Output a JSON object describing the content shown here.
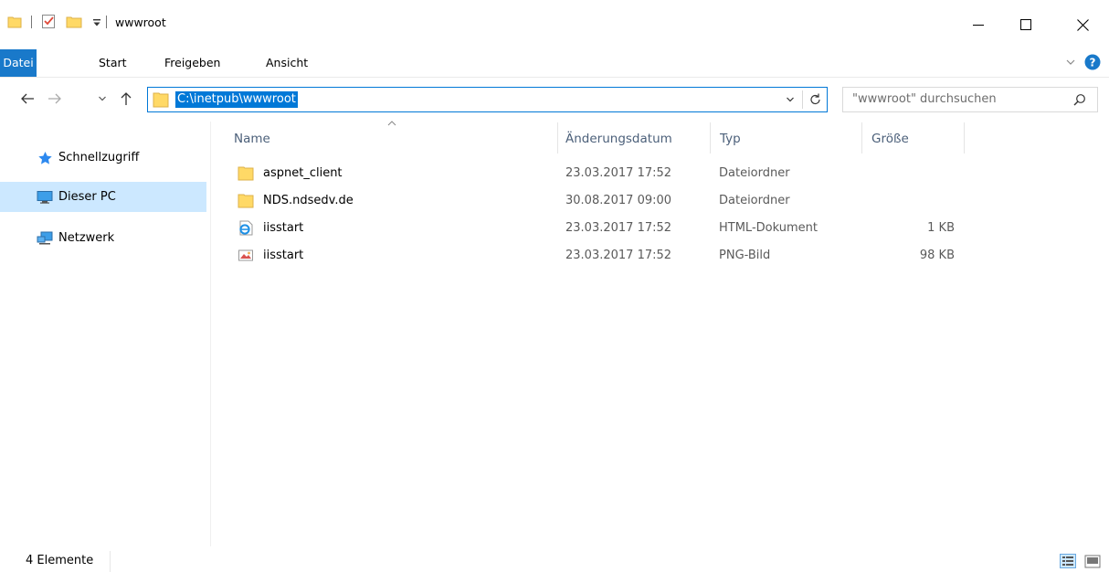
{
  "window": {
    "title": "wwwroot",
    "quick_access_icons": [
      "folder-icon",
      "properties-check-icon",
      "new-folder-icon",
      "customize-dropdown-icon"
    ],
    "controls": [
      "minimize-icon",
      "maximize-icon",
      "close-icon"
    ]
  },
  "ribbon": {
    "tabs": [
      {
        "label": "Datei",
        "active": true
      },
      {
        "label": "Start"
      },
      {
        "label": "Freigeben"
      },
      {
        "label": "Ansicht"
      }
    ]
  },
  "address": {
    "path": "C:\\inetpub\\wwwroot",
    "search_placeholder": "\"wwwroot\" durchsuchen"
  },
  "nav": {
    "items": [
      {
        "label": "Schnellzugriff",
        "icon": "star-icon"
      },
      {
        "label": "Dieser PC",
        "icon": "computer-icon",
        "selected": true
      },
      {
        "label": "Netzwerk",
        "icon": "network-icon"
      }
    ]
  },
  "columns": {
    "name": "Name",
    "date": "Änderungsdatum",
    "type": "Typ",
    "size": "Größe"
  },
  "files": [
    {
      "name": "aspnet_client",
      "date": "23.03.2017 17:52",
      "type": "Dateiordner",
      "size": "",
      "icon": "folder-icon"
    },
    {
      "name": "NDS.ndsedv.de",
      "date": "30.08.2017 09:00",
      "type": "Dateiordner",
      "size": "",
      "icon": "folder-icon"
    },
    {
      "name": "iisstart",
      "date": "23.03.2017 17:52",
      "type": "HTML-Dokument",
      "size": "1 KB",
      "icon": "ie-html-icon"
    },
    {
      "name": "iisstart",
      "date": "23.03.2017 17:52",
      "type": "PNG-Bild",
      "size": "98 KB",
      "icon": "png-image-icon"
    }
  ],
  "status": {
    "count": "4 Elemente"
  },
  "colors": {
    "accent": "#0078d7",
    "datei_tab": "#1979ca",
    "selected_nav": "#cce8ff",
    "folder": "#ffd966"
  }
}
